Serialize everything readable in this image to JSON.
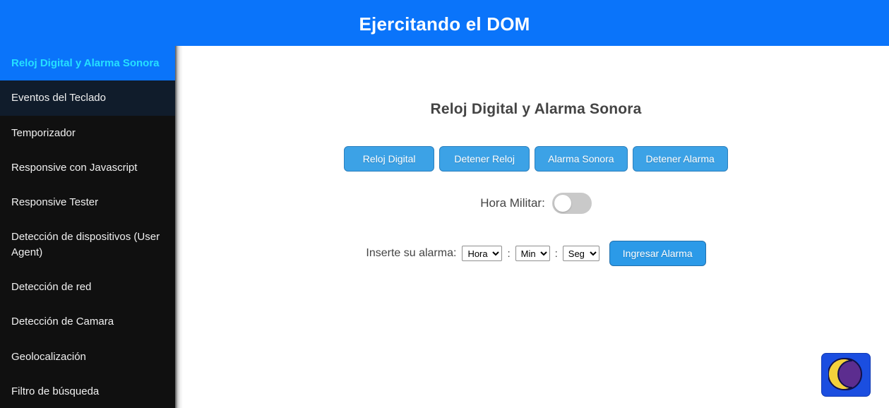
{
  "header": {
    "title": "Ejercitando el DOM"
  },
  "sidebar": {
    "items": [
      {
        "label": "Reloj Digital y Alarma Sonora",
        "state": "active"
      },
      {
        "label": "Eventos del Teclado",
        "state": "hovered"
      },
      {
        "label": "Temporizador",
        "state": "normal"
      },
      {
        "label": "Responsive con Javascript",
        "state": "normal"
      },
      {
        "label": "Responsive Tester",
        "state": "normal"
      },
      {
        "label": "Detección de dispositivos (User Agent)",
        "state": "normal"
      },
      {
        "label": "Detección de red",
        "state": "normal"
      },
      {
        "label": "Detección de Camara",
        "state": "normal"
      },
      {
        "label": "Geolocalización",
        "state": "normal"
      },
      {
        "label": "Filtro de búsqueda",
        "state": "normal"
      }
    ]
  },
  "main": {
    "section_title": "Reloj Digital y Alarma Sonora",
    "buttons": [
      {
        "label": "Reloj Digital"
      },
      {
        "label": "Detener Reloj"
      },
      {
        "label": "Alarma Sonora"
      },
      {
        "label": "Detener Alarma"
      }
    ],
    "military_time": {
      "label": "Hora Militar:",
      "checked": false
    },
    "alarm": {
      "label": "Inserte su alarma:",
      "hour_selected": "Hora",
      "minute_selected": "Min",
      "second_selected": "Seg",
      "separator": ":",
      "submit_label": "Ingresar Alarma"
    },
    "dark_mode_button": {
      "icon": "moon-icon"
    }
  },
  "colors": {
    "header_blue": "#0a74fa",
    "sidebar_dark": "#101010",
    "sidebar_active_text": "#25e0ff",
    "button_blue": "#3ca2e6",
    "submit_blue": "#2b9ae8",
    "moon_yellow": "#f3d13b",
    "moon_purple": "#5c2d8f",
    "darkmode_bg": "#1b4ee0"
  }
}
